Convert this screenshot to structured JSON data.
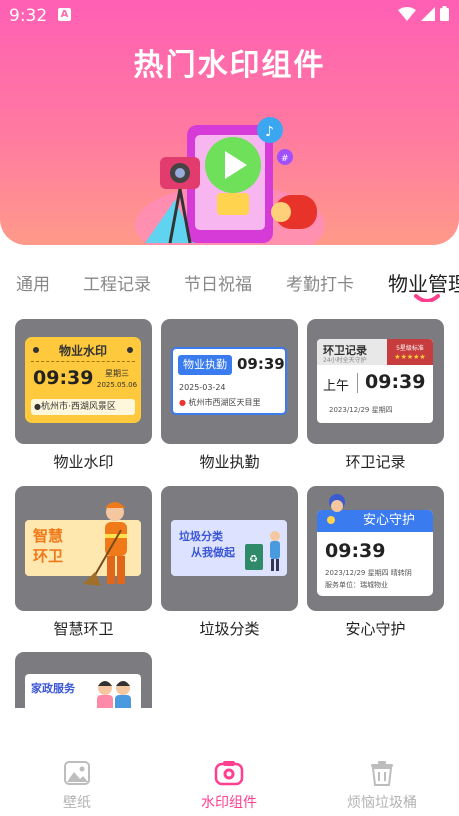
{
  "status_bar": {
    "time": "9:32",
    "notification_letter": "A"
  },
  "hero": {
    "title": "热门水印组件"
  },
  "tabs": [
    {
      "label": "通用"
    },
    {
      "label": "工程记录"
    },
    {
      "label": "节日祝福"
    },
    {
      "label": "考勤打卡"
    },
    {
      "label": "物业管理",
      "active": true
    }
  ],
  "grid": [
    {
      "label": "物业水印",
      "preview": {
        "title": "物业水印",
        "time": "09:39",
        "weekday": "星期三",
        "date": "2025.05.06",
        "location": "杭州市·西湖风景区"
      }
    },
    {
      "label": "物业执勤",
      "preview": {
        "badge": "物业执勤",
        "time": "09:39",
        "date": "2025-03-24",
        "location": "杭州市西湖区天目里"
      }
    },
    {
      "label": "环卫记录",
      "preview": {
        "title": "环卫记录",
        "subtitle": "24小时全天守护",
        "ribbon": "5星级标准",
        "ampm": "上午",
        "time": "09:39",
        "date": "2023/12/29 星期四"
      }
    },
    {
      "label": "智慧环卫",
      "preview": {
        "line1": "智慧",
        "line2": "环卫"
      }
    },
    {
      "label": "垃圾分类",
      "preview": {
        "line1": "垃圾分类",
        "line2": "从我做起"
      }
    },
    {
      "label": "安心守护",
      "preview": {
        "title": "安心守护",
        "time": "09:39",
        "date": "2023/12/29 星期四 晴转阴",
        "org": "服务单位：瑞城物业"
      }
    },
    {
      "label": "",
      "preview": {
        "title": "家政服务"
      }
    }
  ],
  "bottom_nav": [
    {
      "label": "壁纸",
      "icon": "image-icon",
      "active": false
    },
    {
      "label": "水印组件",
      "icon": "camera-icon",
      "active": true
    },
    {
      "label": "烦恼垃圾桶",
      "icon": "trash-icon",
      "active": false
    }
  ],
  "colors": {
    "accent": "#ff3f8f",
    "hero_top": "#ff5fb4",
    "card_bg": "#7c7c80",
    "inactive": "#b3b3b3"
  }
}
